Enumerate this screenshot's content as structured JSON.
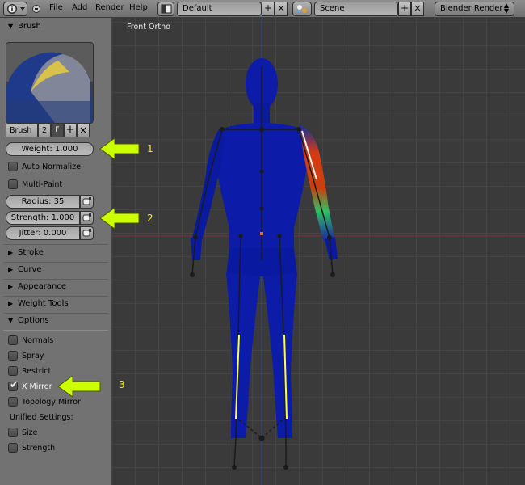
{
  "header": {
    "menus": [
      "File",
      "Add",
      "Render",
      "Help"
    ],
    "layout_value": "Default",
    "scene_value": "Scene",
    "render_engine": "Blender Render",
    "icons": [
      "info-icon",
      "collapse-icon",
      "layout-icon",
      "scene-icon"
    ]
  },
  "panel": {
    "brush_section": "Brush",
    "brush_name": "Brush",
    "brush_users": "2",
    "brush_fake_user": "F",
    "weight_label": "Weight: 1.000",
    "auto_normalize": {
      "label": "Auto Normalize",
      "checked": false
    },
    "multi_paint": {
      "label": "Multi-Paint",
      "checked": false
    },
    "radius_label": "Radius: 35",
    "strength_label": "Strength: 1.000",
    "jitter_label": "Jitter: 0.000",
    "collapsed_sections": [
      "Stroke",
      "Curve",
      "Appearance",
      "Weight Tools"
    ],
    "options_section": "Options",
    "options": [
      {
        "label": "Normals",
        "checked": false
      },
      {
        "label": "Spray",
        "checked": false
      },
      {
        "label": "Restrict",
        "checked": false
      },
      {
        "label": "X Mirror",
        "checked": true
      },
      {
        "label": "Topology Mirror",
        "checked": false
      }
    ],
    "unified_label": "Unified Settings:",
    "unified": [
      {
        "label": "Size",
        "checked": false
      },
      {
        "label": "Strength",
        "checked": false
      }
    ]
  },
  "viewport": {
    "view_label": "Front Ortho"
  },
  "annotations": [
    "1",
    "2",
    "3"
  ],
  "colors": {
    "annotation_arrow": "#ccff00",
    "weight_low": "#0a1aa0",
    "weight_high": "#d43010",
    "bone_selected": "#ffff40"
  }
}
